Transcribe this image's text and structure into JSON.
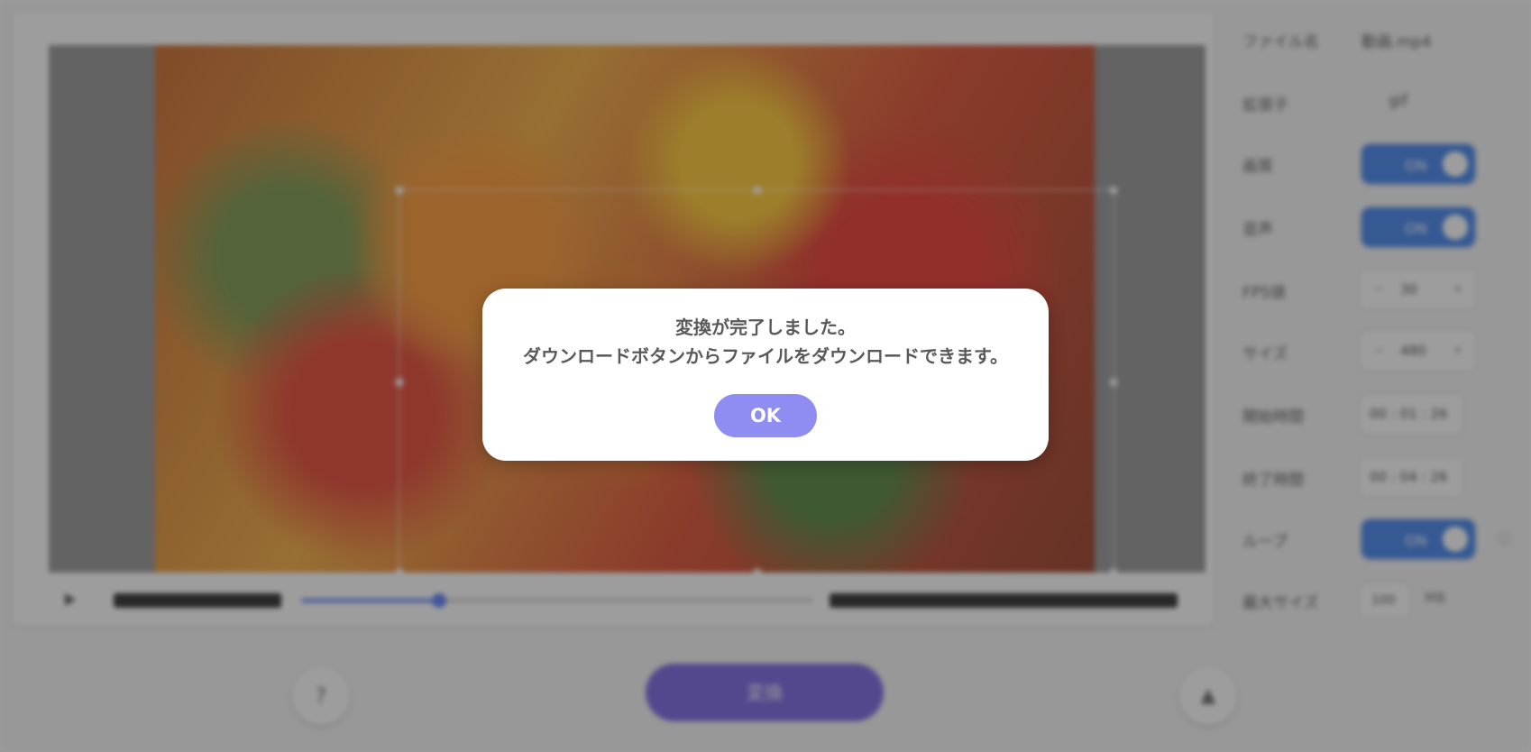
{
  "dialog": {
    "line1": "変換が完了しました。",
    "line2": "ダウンロードボタンからファイルをダウンロードできます。",
    "ok_label": "OK",
    "ok_color": "#8f8df2"
  },
  "background": {
    "blurred": true,
    "settings": {
      "file_name": {
        "label": "ファイル名",
        "value": "動画.mp4"
      },
      "extension": {
        "label": "拡張子",
        "value": "gif"
      },
      "toggle_1": {
        "label": "画質",
        "value": "ON"
      },
      "toggle_2": {
        "label": "音声",
        "value": "ON"
      },
      "fps": {
        "label": "FPS値",
        "value": "30"
      },
      "size": {
        "label": "サイズ",
        "value": "480"
      },
      "start_time": {
        "label": "開始時間",
        "value": "00 : 01 : 26"
      },
      "end_time": {
        "label": "終了時間",
        "value": "00 : 04 : 26"
      },
      "loop": {
        "label": "ループ",
        "value": "ON"
      },
      "max_size": {
        "label": "最大サイズ",
        "value": "100",
        "unit": "MB"
      }
    },
    "timeline": {
      "seek_position": 0.27,
      "seek_color": "#4a6cff"
    },
    "toolbar": {
      "help_icon": "question-icon",
      "convert_label": "変換",
      "convert_color": "#6a55e0",
      "up_icon": "arrow-up-icon"
    }
  }
}
